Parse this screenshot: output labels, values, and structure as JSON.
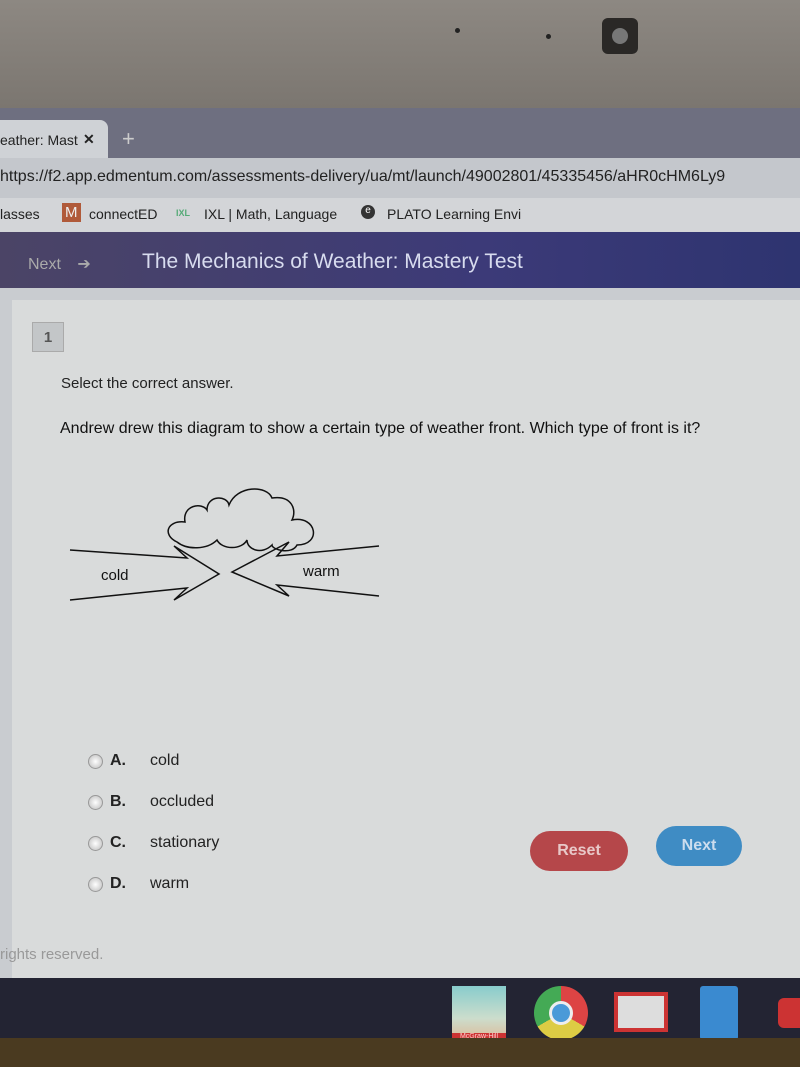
{
  "browser": {
    "tab_title": "eather: Mast",
    "tab_close": "✕",
    "new_tab": "+",
    "url": "https://f2.app.edmentum.com/assessments-delivery/ua/mt/launch/49002801/45335456/aHR0cHM6Ly9",
    "bookmarks": [
      {
        "label": "lasses"
      },
      {
        "label": "connectED",
        "icon": "M"
      },
      {
        "label": "IXL | Math, Language",
        "icon": "IXL"
      },
      {
        "label": "PLATO Learning Envi",
        "icon": "e"
      }
    ]
  },
  "header": {
    "next_label": "Next",
    "title": "The Mechanics of Weather: Mastery Test"
  },
  "question": {
    "number": "1",
    "instruction": "Select the correct answer.",
    "text": "Andrew drew this diagram to show a certain type of weather front. Which type of front is it?",
    "diagram": {
      "left_label": "cold",
      "right_label": "warm"
    },
    "options": [
      {
        "letter": "A.",
        "text": "cold"
      },
      {
        "letter": "B.",
        "text": "occluded"
      },
      {
        "letter": "C.",
        "text": "stationary"
      },
      {
        "letter": "D.",
        "text": "warm"
      }
    ],
    "selected": null
  },
  "buttons": {
    "reset": "Reset",
    "next": "Next"
  },
  "footer": "rights reserved.",
  "shelf": {
    "apps": [
      "McGraw-Hill",
      "chrome-icon",
      "gmail-icon",
      "docs-icon",
      "youtube-icon"
    ],
    "mcgraw_label": "McGraw-Hill"
  },
  "colors": {
    "header": "#3c3a78",
    "reset": "#b5474a",
    "next": "#3f8cc4"
  }
}
